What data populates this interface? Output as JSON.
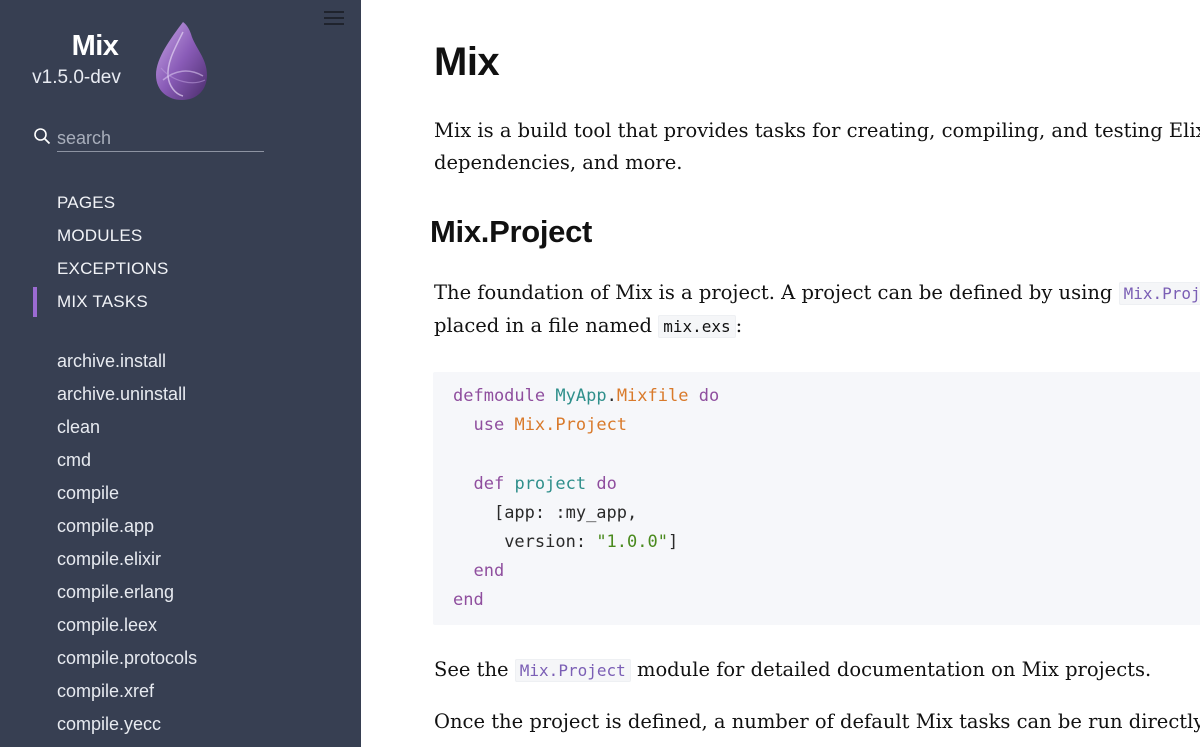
{
  "sidebar": {
    "project_name": "Mix",
    "version": "v1.5.0-dev",
    "search_placeholder": "search",
    "sections": [
      {
        "label": "PAGES"
      },
      {
        "label": "MODULES"
      },
      {
        "label": "EXCEPTIONS"
      },
      {
        "label": "MIX TASKS",
        "active": true
      }
    ],
    "tasks": [
      "archive.install",
      "archive.uninstall",
      "clean",
      "cmd",
      "compile",
      "compile.app",
      "compile.elixir",
      "compile.erlang",
      "compile.leex",
      "compile.protocols",
      "compile.xref",
      "compile.yecc"
    ],
    "accent_color": "#9b6bd2",
    "background_color": "#373f52"
  },
  "content": {
    "title": "Mix",
    "intro_line1": "Mix is a build tool that provides tasks for creating, compiling, and testing Elixir",
    "intro_line2": "dependencies, and more.",
    "section_heading": "Mix.Project",
    "foundation_text1": "The foundation of Mix is a project. A project can be defined by using",
    "foundation_code1": "Mix.Project",
    "foundation_text2": "placed in a file named",
    "foundation_code2": "mix.exs",
    "foundation_text3": ":",
    "code": {
      "l1_kw1": "defmodule",
      "l1_mod1": "MyApp",
      "l1_dot": ".",
      "l1_mod2": "Mixfile",
      "l1_kw2": "do",
      "l2_kw": "use",
      "l2_mod": "Mix.Project",
      "l4_kw1": "def",
      "l4_fn": "project",
      "l4_kw2": "do",
      "l5": "[app: :my_app,",
      "l6_key": "version: ",
      "l6_str": "\"1.0.0\"",
      "l6_end": "]",
      "l7": "end",
      "l8": "end"
    },
    "see_text1": "See the",
    "see_code": "Mix.Project",
    "see_text2": "module for detailed documentation on Mix projects.",
    "once_text": "Once the project is defined, a number of default Mix tasks can be run directly fro"
  }
}
